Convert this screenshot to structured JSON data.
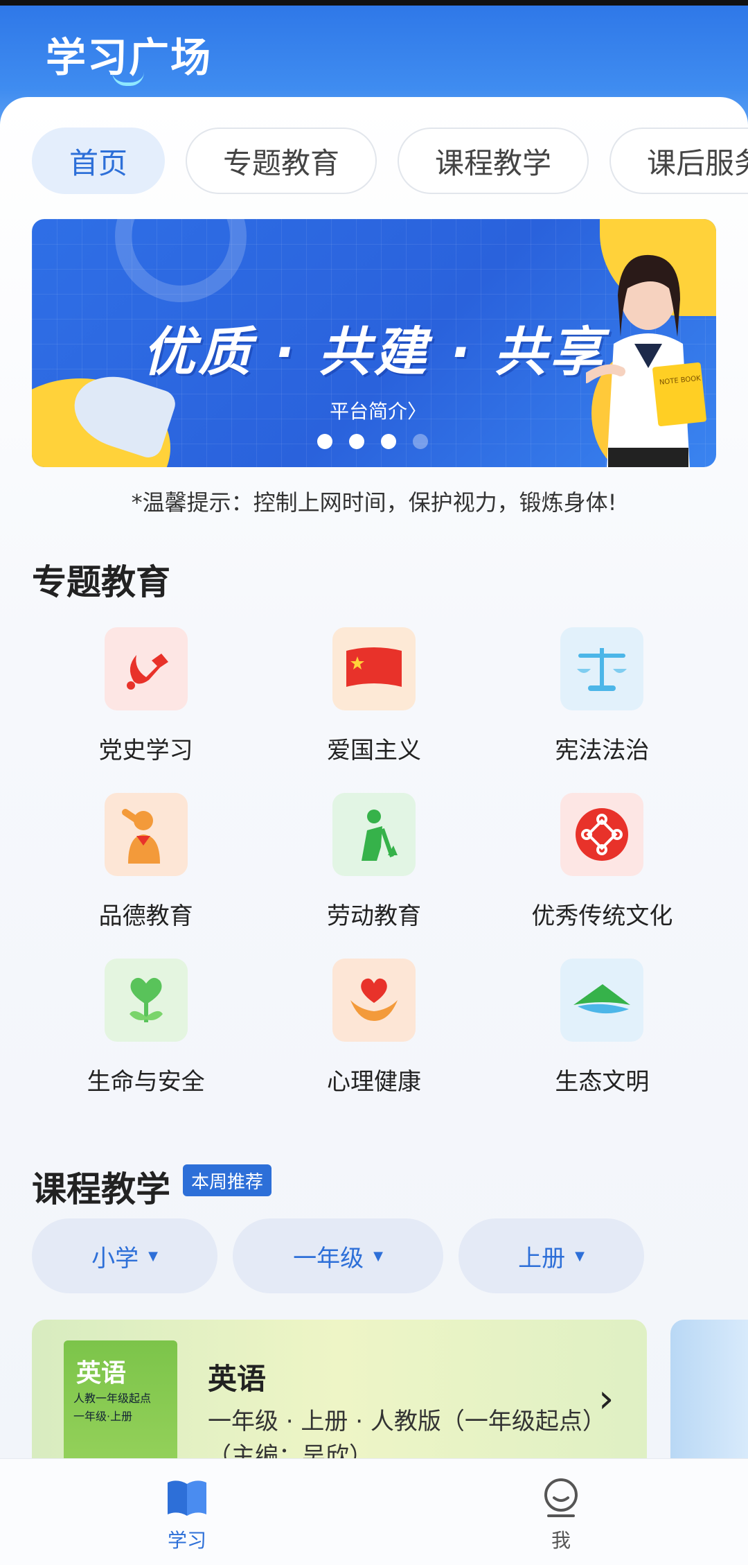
{
  "header": {
    "app_title": "学习广场"
  },
  "tabs": [
    {
      "label": "首页",
      "active": true
    },
    {
      "label": "专题教育",
      "active": false
    },
    {
      "label": "课程教学",
      "active": false
    },
    {
      "label": "课后服务",
      "active": false
    }
  ],
  "banner": {
    "slogan": "优质 · 共建 · 共享",
    "link_text": "平台简介〉",
    "book_label": "NOTE BOOK",
    "slide_count": 4,
    "active_slide": 1
  },
  "tip": "*温馨提示：控制上网时间，保护视力，锻炼身体!",
  "special_education": {
    "title": "专题教育",
    "items": [
      {
        "label": "党史学习",
        "icon": "party-emblem-icon"
      },
      {
        "label": "爱国主义",
        "icon": "national-flag-icon"
      },
      {
        "label": "宪法法治",
        "icon": "scales-icon"
      },
      {
        "label": "品德教育",
        "icon": "salute-student-icon"
      },
      {
        "label": "劳动教育",
        "icon": "labor-worker-icon"
      },
      {
        "label": "优秀传统文化",
        "icon": "chinese-knot-icon"
      },
      {
        "label": "生命与安全",
        "icon": "sprout-heart-icon"
      },
      {
        "label": "心理健康",
        "icon": "heart-hands-icon"
      },
      {
        "label": "生态文明",
        "icon": "mountain-eco-icon"
      }
    ]
  },
  "course_teaching": {
    "title": "课程教学",
    "badge": "本周推荐",
    "filters": [
      {
        "label": "小学"
      },
      {
        "label": "一年级"
      },
      {
        "label": "上册"
      }
    ],
    "course": {
      "cover_title": "英语",
      "cover_line1": "人教一年级起点",
      "cover_line2": "一年级·上册",
      "name": "英语",
      "description": "一年级 · 上册 · 人教版（一年级起点）（主编：吴欣）"
    }
  },
  "bottom_nav": [
    {
      "label": "学习",
      "icon": "book-icon",
      "active": true
    },
    {
      "label": "我",
      "icon": "profile-icon",
      "active": false
    }
  ],
  "colors": {
    "primary": "#2d6fd8",
    "header": "#2f78e8",
    "accent_yellow": "#ffd23a"
  }
}
